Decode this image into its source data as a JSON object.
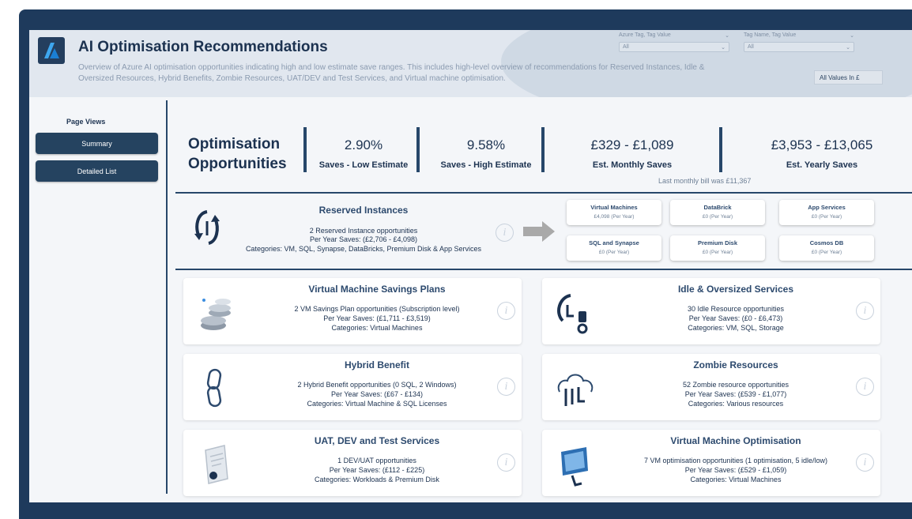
{
  "header": {
    "title": "AI Optimisation Recommendations",
    "subtitle": "Overview of Azure AI optimisation opportunities indicating high and low estimate save ranges. This includes high-level overview of recommendations for Reserved Instances, Idle & Oversized Resources, Hybrid Benefits, Zombie Resources, UAT/DEV and Test Services, and Virtual machine optimisation.",
    "filters": [
      {
        "label": "Azure Tag, Tag Value",
        "value": "All"
      },
      {
        "label": "Tag Name, Tag Value",
        "value": "All"
      }
    ],
    "all_values_button": "All Values In £"
  },
  "sidebar": {
    "label": "Page Views",
    "items": [
      {
        "label": "Summary"
      },
      {
        "label": "Detailed List"
      }
    ]
  },
  "kpis": {
    "title_line1": "Optimisation",
    "title_line2": "Opportunities",
    "items": [
      {
        "value": "2.90%",
        "label": "Saves - Low Estimate"
      },
      {
        "value": "9.58%",
        "label": "Saves - High Estimate"
      },
      {
        "value": "£329 - £1,089",
        "label": "Est. Monthly Saves"
      },
      {
        "value": "£3,953 - £13,065",
        "label": "Est. Yearly Saves"
      }
    ],
    "last_bill": "Last monthly bill was £11,367"
  },
  "reserved": {
    "title": "Reserved Instances",
    "line1": "2 Reserved Instance opportunities",
    "line2": "Per Year Saves: (£2,706 - £4,098)",
    "line3": "Categories: VM, SQL, Synapse, DataBricks, Premium Disk & App Services",
    "cards": [
      {
        "name": "Virtual Machines",
        "value": "£4,098 (Per Year)"
      },
      {
        "name": "DataBrick",
        "value": "£0 (Per Year)"
      },
      {
        "name": "App Services",
        "value": "£0 (Per Year)"
      },
      {
        "name": "SQL and Synapse",
        "value": "£0 (Per Year)"
      },
      {
        "name": "Premium Disk",
        "value": "£0 (Per Year)"
      },
      {
        "name": "Cosmos DB",
        "value": "£0 (Per Year)"
      }
    ]
  },
  "cards": [
    {
      "title": "Virtual Machine Savings Plans",
      "line1": "2 VM Savings Plan opportunities (Subscription level)",
      "line2": "Per Year Saves: (£1,711 - £3,519)",
      "line3": "Categories: Virtual Machines",
      "icon": "coins-icon"
    },
    {
      "title": "Idle & Oversized Services",
      "line1": "30 Idle Resource opportunities",
      "line2": "Per Year Saves: (£0 - £6,473)",
      "line3": "Categories: VM, SQL, Storage",
      "icon": "hourglass-icon"
    },
    {
      "title": "Hybrid Benefit",
      "line1": "2 Hybrid Benefit opportunities (0 SQL, 2 Windows)",
      "line2": "Per Year Saves: (£67 - £134)",
      "line3": "Categories: Virtual Machine & SQL Licenses",
      "icon": "link-icon"
    },
    {
      "title": "Zombie Resources",
      "line1": "52 Zombie resource opportunities",
      "line2": "Per Year Saves: (£539 - £1,077)",
      "line3": "Categories: Various resources",
      "icon": "cloud-transfer-icon"
    },
    {
      "title": "UAT, DEV and Test Services",
      "line1": "1 DEV/UAT opportunities",
      "line2": "Per Year Saves: (£112 - £225)",
      "line3": "Categories: Workloads & Premium Disk",
      "icon": "clipboard-gear-icon"
    },
    {
      "title": "Virtual Machine Optimisation",
      "line1": "7 VM optimisation opportunities (1 optimisation, 5 idle/low)",
      "line2": "Per Year Saves: (£529 - £1,059)",
      "line3": "Categories: Virtual Machines",
      "icon": "monitor-icon"
    }
  ],
  "info_glyph": "i"
}
